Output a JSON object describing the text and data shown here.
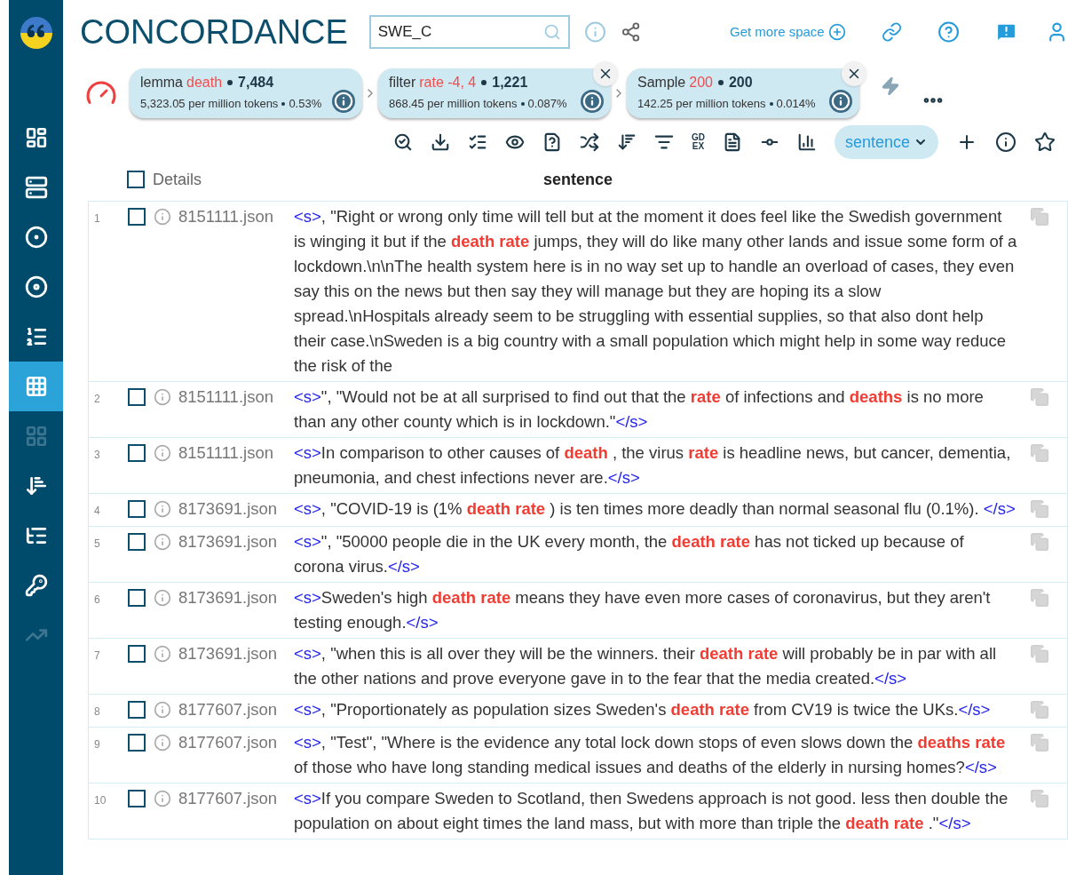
{
  "header": {
    "title": "CONCORDANCE",
    "corpus_field": {
      "value": "SWE_C"
    },
    "more_space_link": "Get more space"
  },
  "sidebar": {
    "items": [
      {
        "selected": false,
        "disabled": false
      },
      {
        "selected": false,
        "disabled": false
      },
      {
        "selected": false,
        "disabled": false
      },
      {
        "selected": false,
        "disabled": false
      },
      {
        "selected": false,
        "disabled": false
      },
      {
        "selected": true,
        "disabled": false
      },
      {
        "selected": false,
        "disabled": true
      },
      {
        "selected": false,
        "disabled": false
      },
      {
        "selected": false,
        "disabled": false
      },
      {
        "selected": false,
        "disabled": false
      },
      {
        "selected": false,
        "disabled": true
      }
    ]
  },
  "query_chips": [
    {
      "label": "lemma",
      "value": "death",
      "count": "7,484",
      "frequency": "5,323.05 per million tokens",
      "share": "0.53%",
      "closable": false
    },
    {
      "label": "filter",
      "value": "rate -4, 4",
      "count": "1,221",
      "frequency": "868.45 per million tokens",
      "share": "0.087%",
      "closable": true
    },
    {
      "label": "Sample",
      "value": "200",
      "count": "200",
      "frequency": "142.25 per million tokens",
      "share": "0.014%",
      "closable": true
    }
  ],
  "toolbar": {
    "gdex_label": [
      "GD",
      "EX"
    ],
    "view_select": "sentence"
  },
  "table": {
    "select_all": {
      "checked": false
    },
    "columns": [
      "Details",
      "sentence"
    ],
    "rows": [
      {
        "number": "1",
        "checked": false,
        "document": "8151111.json",
        "segments": [
          {
            "kind": "tag",
            "text": "<s>"
          },
          {
            "kind": "text",
            "text": ", \"Right or wrong only time will tell but at the moment it does feel like the Swedish government is winging it but if the "
          },
          {
            "kind": "hit",
            "text": "death rate"
          },
          {
            "kind": "text",
            "text": " jumps, they will do like many other lands and issue some form of a lockdown.\\n\\nThe health system here is in no way set up to handle an overload of cases, they even say this on the news but then say they will manage but they are hoping its a slow spread.\\nHospitals already seem to be struggling with essential supplies, so that also dont help their case.\\nSweden is a big country with a small population which might help in some way reduce the risk of the"
          }
        ]
      },
      {
        "number": "2",
        "checked": false,
        "document": "8151111.json",
        "segments": [
          {
            "kind": "tag",
            "text": "<s>"
          },
          {
            "kind": "text",
            "text": "\", \"Would not be at all surprised to find out that the "
          },
          {
            "kind": "hit",
            "text": "rate"
          },
          {
            "kind": "text",
            "text": " of infections and "
          },
          {
            "kind": "hit",
            "text": "deaths"
          },
          {
            "kind": "text",
            "text": " is no more than any other county which is in lockdown.\""
          },
          {
            "kind": "tag",
            "text": "</s>"
          }
        ]
      },
      {
        "number": "3",
        "checked": false,
        "document": "8151111.json",
        "segments": [
          {
            "kind": "tag",
            "text": "<s>"
          },
          {
            "kind": "text",
            "text": "In comparison to other causes of "
          },
          {
            "kind": "hit",
            "text": "death"
          },
          {
            "kind": "text",
            "text": " , the virus "
          },
          {
            "kind": "hit",
            "text": "rate"
          },
          {
            "kind": "text",
            "text": " is headline news, but cancer, dementia, pneumonia, and chest infections never are."
          },
          {
            "kind": "tag",
            "text": "</s>"
          }
        ]
      },
      {
        "number": "4",
        "checked": false,
        "document": "8173691.json",
        "segments": [
          {
            "kind": "tag",
            "text": "<s>"
          },
          {
            "kind": "text",
            "text": ", \"COVID-19 is (1% "
          },
          {
            "kind": "hit",
            "text": "death rate"
          },
          {
            "kind": "text",
            "text": " ) is ten times more deadly than normal seasonal flu (0.1%). "
          },
          {
            "kind": "tag",
            "text": "</s>"
          }
        ]
      },
      {
        "number": "5",
        "checked": false,
        "document": "8173691.json",
        "segments": [
          {
            "kind": "tag",
            "text": "<s>"
          },
          {
            "kind": "text",
            "text": "\", \"50000 people die in the UK every month, the "
          },
          {
            "kind": "hit",
            "text": "death rate"
          },
          {
            "kind": "text",
            "text": " has not ticked up because of corona virus."
          },
          {
            "kind": "tag",
            "text": "</s>"
          }
        ]
      },
      {
        "number": "6",
        "checked": false,
        "document": "8173691.json",
        "segments": [
          {
            "kind": "tag",
            "text": "<s>"
          },
          {
            "kind": "text",
            "text": "Sweden's high "
          },
          {
            "kind": "hit",
            "text": "death rate"
          },
          {
            "kind": "text",
            "text": " means they have even more cases of coronavirus, but they aren't testing enough."
          },
          {
            "kind": "tag",
            "text": "</s>"
          }
        ]
      },
      {
        "number": "7",
        "checked": false,
        "document": "8173691.json",
        "segments": [
          {
            "kind": "tag",
            "text": "<s>"
          },
          {
            "kind": "text",
            "text": ", \"when this is all over they will be the winners. their "
          },
          {
            "kind": "hit",
            "text": "death rate"
          },
          {
            "kind": "text",
            "text": " will probably be in par with all the other nations and prove everyone gave in to the fear that the media created."
          },
          {
            "kind": "tag",
            "text": "</s>"
          }
        ]
      },
      {
        "number": "8",
        "checked": false,
        "document": "8177607.json",
        "segments": [
          {
            "kind": "tag",
            "text": "<s>"
          },
          {
            "kind": "text",
            "text": ", \"Proportionately as population sizes Sweden's "
          },
          {
            "kind": "hit",
            "text": "death rate"
          },
          {
            "kind": "text",
            "text": " from CV19 is twice the UKs."
          },
          {
            "kind": "tag",
            "text": "</s>"
          }
        ]
      },
      {
        "number": "9",
        "checked": false,
        "document": "8177607.json",
        "segments": [
          {
            "kind": "tag",
            "text": "<s>"
          },
          {
            "kind": "text",
            "text": ", \"Test\", \"Where is the evidence any total lock down stops of even slows down the "
          },
          {
            "kind": "hit",
            "text": "deaths rate"
          },
          {
            "kind": "text",
            "text": " of those who have long standing medical issues and deaths of the elderly in nursing homes?"
          },
          {
            "kind": "tag",
            "text": "</s>"
          }
        ]
      },
      {
        "number": "10",
        "checked": false,
        "document": "8177607.json",
        "segments": [
          {
            "kind": "tag",
            "text": "<s>"
          },
          {
            "kind": "text",
            "text": "If you compare Sweden to Scotland, then Swedens approach is not good. less then double the population on about eight times the land mass, but with more than triple the "
          },
          {
            "kind": "hit",
            "text": "death rate"
          },
          {
            "kind": "text",
            "text": " .\""
          },
          {
            "kind": "tag",
            "text": "</s>"
          }
        ]
      }
    ]
  }
}
